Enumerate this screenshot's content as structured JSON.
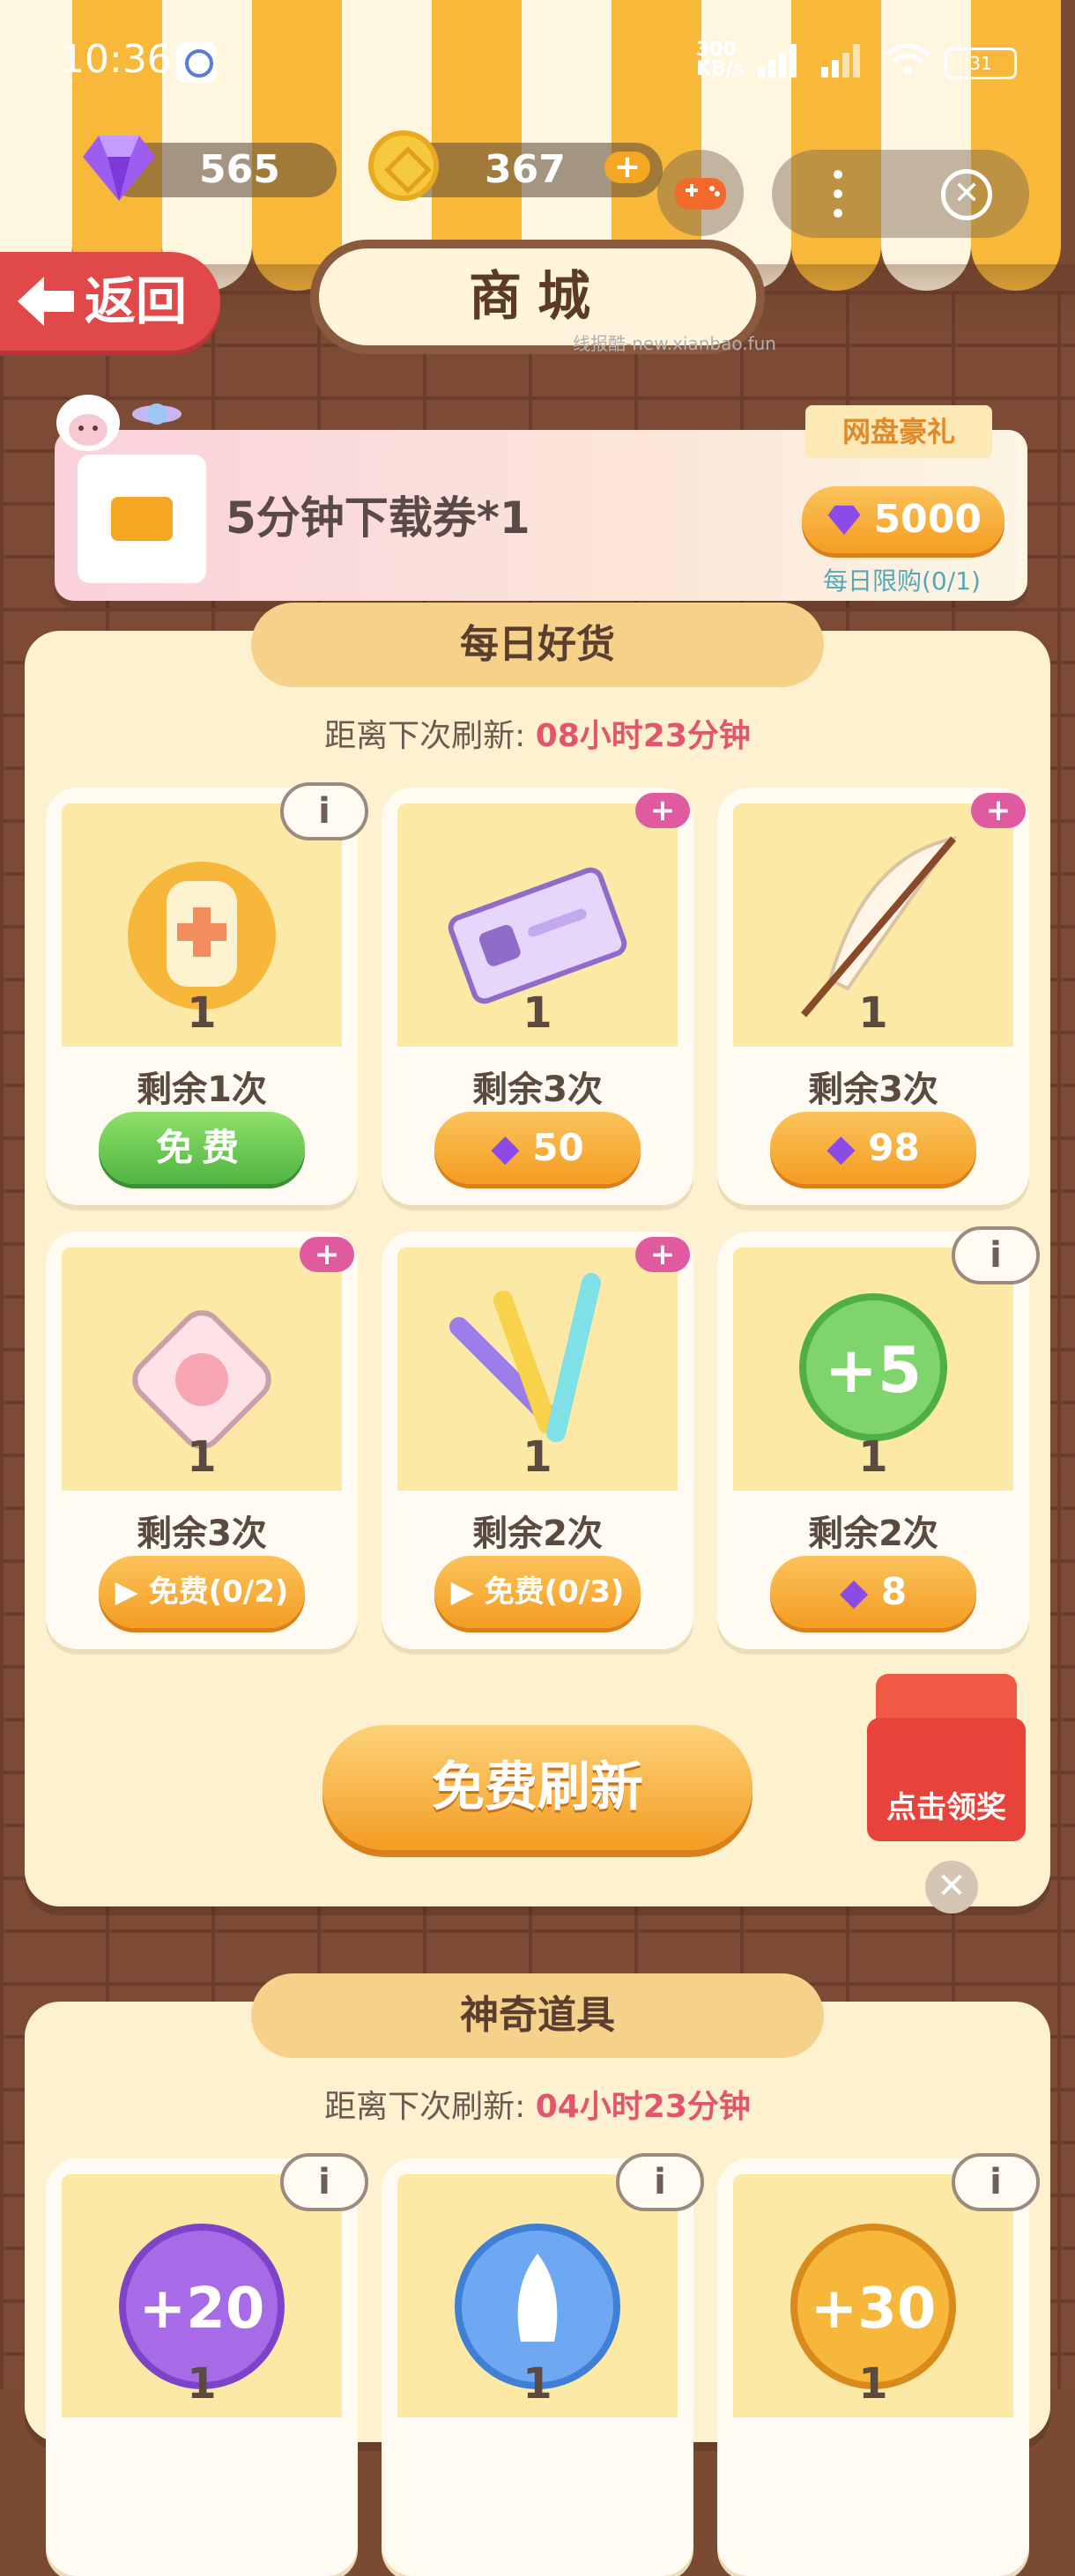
{
  "status": {
    "time": "10:36",
    "net_speed_top": "300",
    "net_speed_bottom": "KB/s",
    "battery": "31",
    "colors": {
      "text": "#ffffff"
    }
  },
  "currency": {
    "gems": "565",
    "coins": "367",
    "gem_icon": "purple-gem-icon",
    "coin_icon": "gold-coin-icon",
    "add_symbol": "+"
  },
  "nav": {
    "back_label": "返回",
    "title": "商城",
    "watermark": "线报酷-new.xianbao.fun",
    "close_symbol": "✕"
  },
  "promo": {
    "tag": "网盘豪礼",
    "item_name": "5分钟下载券*1",
    "price": "5000",
    "limit": "每日限购(0/1)"
  },
  "daily": {
    "title": "每日好货",
    "refresh_label": "距离下次刷新:",
    "refresh_time": "08小时23分钟",
    "items": [
      {
        "qty": "1",
        "remain": "剩余1次",
        "button": "免费",
        "style": "green",
        "badge": "i",
        "icon": "battery-icon"
      },
      {
        "qty": "1",
        "remain": "剩余3次",
        "button": "50",
        "style": "orange",
        "badge": "+",
        "icon": "ticket-icon"
      },
      {
        "qty": "1",
        "remain": "剩余3次",
        "button": "98",
        "style": "orange",
        "badge": "+",
        "icon": "feather-icon"
      },
      {
        "qty": "1",
        "remain": "剩余3次",
        "button": "免费(0/2)",
        "style": "orange",
        "badge": "+",
        "icon": "cushion-icon"
      },
      {
        "qty": "1",
        "remain": "剩余2次",
        "button": "免费(0/3)",
        "style": "orange",
        "badge": "+",
        "icon": "glowsticks-icon"
      },
      {
        "qty": "1",
        "remain": "剩余2次",
        "button": "8",
        "style": "orange",
        "badge": "i",
        "icon": "plus5-bubble-icon"
      }
    ],
    "free_refresh": "免费刷新",
    "gift_label": "点击领奖"
  },
  "magic": {
    "title": "神奇道具",
    "refresh_label": "距离下次刷新:",
    "refresh_time": "04小时23分钟",
    "items": [
      {
        "qty": "1",
        "badge": "i",
        "label": "+20",
        "icon": "plus20-bubble-icon"
      },
      {
        "qty": "1",
        "badge": "i",
        "icon": "rocket-bubble-icon"
      },
      {
        "qty": "1",
        "badge": "i",
        "label": "+30",
        "icon": "plus30-bubble-icon"
      }
    ]
  }
}
